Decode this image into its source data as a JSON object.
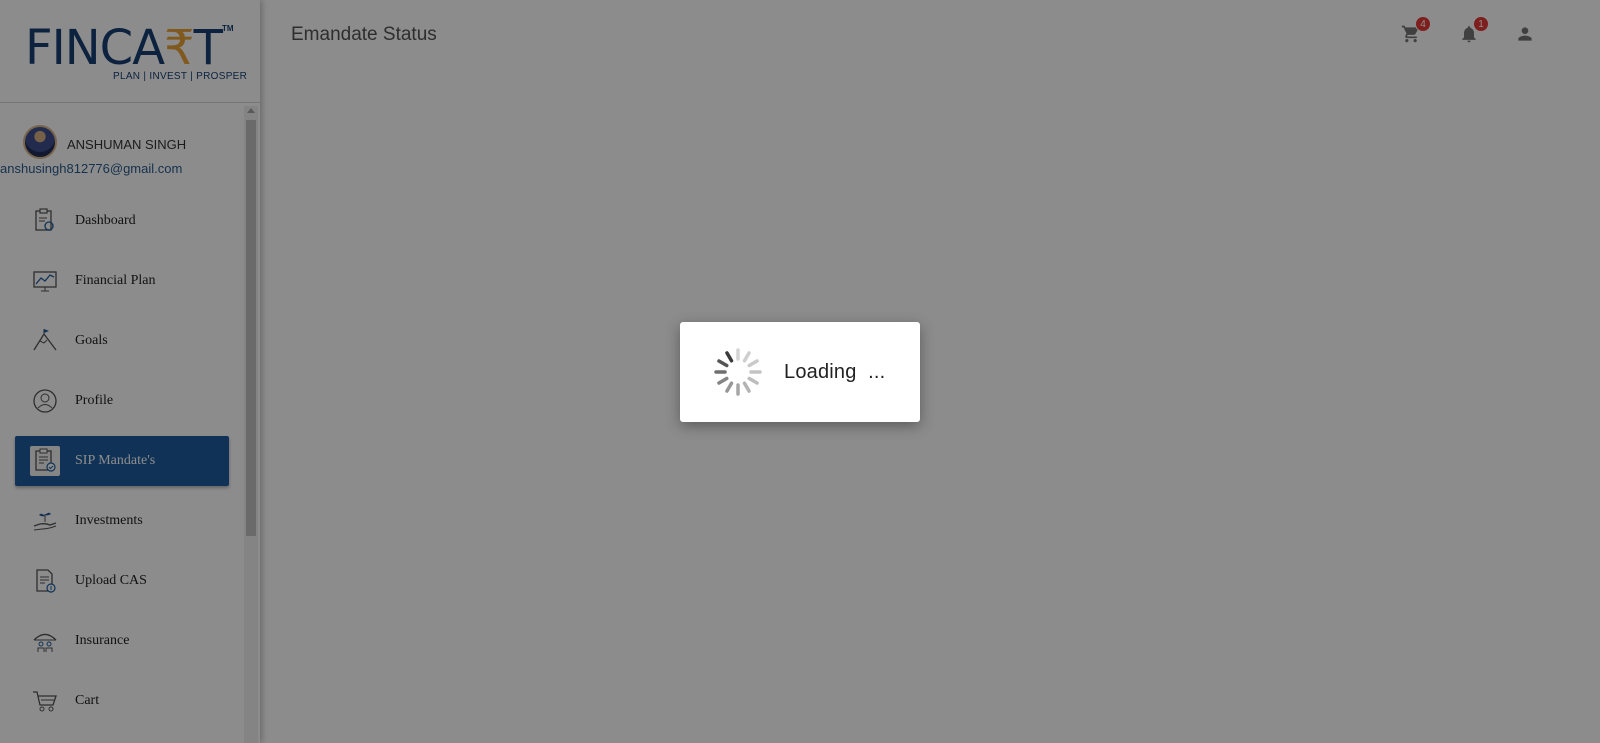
{
  "brand": {
    "logo_main": "FINCA",
    "logo_accent": "₹",
    "logo_end": "T",
    "trademark": "TM",
    "tagline": "PLAN | INVEST | PROSPER"
  },
  "user": {
    "name": "ANSHUMAN SINGH",
    "email": "anshusingh812776@gmail.com"
  },
  "sidebar": {
    "items": [
      {
        "label": "Dashboard",
        "icon": "dashboard-icon",
        "active": false
      },
      {
        "label": "Financial Plan",
        "icon": "chart-icon",
        "active": false
      },
      {
        "label": "Goals",
        "icon": "mountain-icon",
        "active": false
      },
      {
        "label": "Profile",
        "icon": "user-icon",
        "active": false
      },
      {
        "label": "SIP Mandate's",
        "icon": "clipboard-icon",
        "active": true
      },
      {
        "label": "Investments",
        "icon": "hand-plant-icon",
        "active": false
      },
      {
        "label": "Upload CAS",
        "icon": "document-upload-icon",
        "active": false
      },
      {
        "label": "Insurance",
        "icon": "umbrella-family-icon",
        "active": false
      },
      {
        "label": "Cart",
        "icon": "cart-icon",
        "active": false
      }
    ]
  },
  "header": {
    "title": "Emandate Status",
    "cart_count": "4",
    "notification_count": "1"
  },
  "loading": {
    "label": "Loading",
    "dots": "..."
  },
  "colors": {
    "brand_blue": "#173f73",
    "brand_gold": "#e9a23a",
    "active_nav": "#1e5c9e",
    "badge_red": "#e53935",
    "overlay": "rgba(0,0,0,0.45)"
  }
}
